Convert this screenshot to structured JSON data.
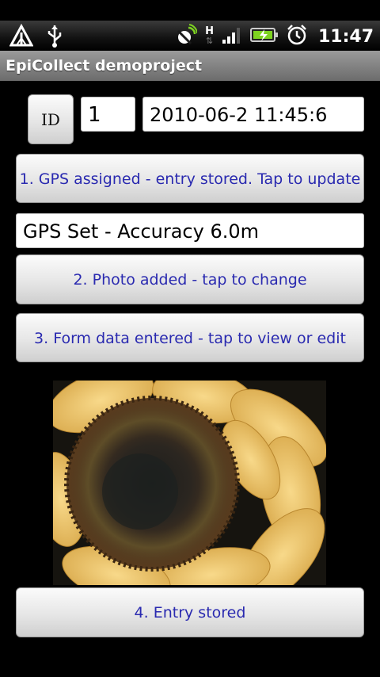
{
  "status": {
    "icons": [
      "signal-triangle-icon",
      "usb-icon",
      "gps-icon",
      "hspa-h-icon",
      "cell-signal-icon",
      "battery-charging-icon",
      "alarm-icon"
    ],
    "network_letter": "H",
    "time": "11:47"
  },
  "app": {
    "title": "EpiCollect demoproject"
  },
  "form": {
    "id_label": "ID",
    "id_value": "1",
    "timestamp": "2010-06-2 11:45:6",
    "gps_button": "1. GPS assigned - entry stored. Tap to update",
    "gps_status": "GPS Set - Accuracy 6.0m",
    "photo_button": "2. Photo added - tap to change",
    "form_button": "3. Form data entered - tap to view or edit",
    "store_button": "4. Entry stored"
  },
  "photo": {
    "subject": "sunflower"
  },
  "colors": {
    "button_text": "#2a2ab0",
    "title_bar": "#7f7f7f"
  }
}
